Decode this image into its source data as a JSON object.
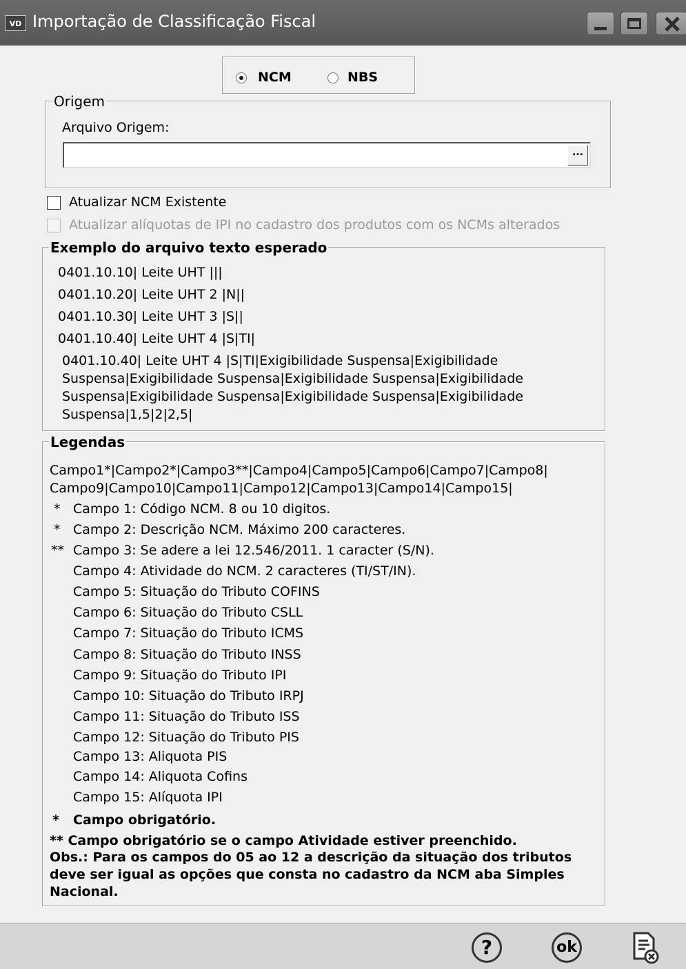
{
  "window": {
    "app_icon": "VD",
    "title": "Importação de Classificação Fiscal"
  },
  "type_selector": {
    "options": [
      {
        "label": "NCM",
        "selected": true
      },
      {
        "label": "NBS",
        "selected": false
      }
    ]
  },
  "origin": {
    "group_title": "Origem",
    "file_label": "Arquivo Origem:",
    "file_value": "",
    "browse_label": "..."
  },
  "options": {
    "update_ncm": {
      "label": "Atualizar NCM Existente",
      "checked": false,
      "enabled": true
    },
    "update_ipi": {
      "label": "Atualizar alíquotas de IPI no cadastro dos produtos com os NCMs alterados",
      "checked": false,
      "enabled": false
    }
  },
  "example": {
    "group_title": "Exemplo do arquivo texto esperado",
    "lines": [
      "0401.10.10| Leite UHT    |||",
      "0401.10.20| Leite UHT 2 |N||",
      "0401.10.30| Leite UHT 3 |S||",
      "0401.10.40| Leite UHT 4 |S|TI|"
    ],
    "long_example": [
      "0401.10.40| Leite UHT 4 |S|TI|Exigibilidade Suspensa|Exigibilidade",
      "Suspensa|Exigibilidade Suspensa|Exigibilidade Suspensa|Exigibilidade",
      "Suspensa|Exigibilidade Suspensa|Exigibilidade Suspensa|Exigibilidade",
      "Suspensa|1,5|2|2,5|"
    ]
  },
  "legend": {
    "group_title": "Legendas",
    "format": [
      "Campo1*|Campo2*|Campo3**|Campo4|Campo5|Campo6|Campo7|Campo8|",
      "Campo9|Campo10|Campo11|Campo12|Campo13|Campo14|Campo15|"
    ],
    "fields": [
      {
        "mark": "*",
        "text": "Campo 1: Código NCM. 8  ou 10 digitos."
      },
      {
        "mark": "*",
        "text": "Campo 2: Descrição NCM. Máximo 200 caracteres."
      },
      {
        "mark": "**",
        "text": "Campo 3: Se adere a lei 12.546/2011. 1 caracter (S/N)."
      },
      {
        "mark": "",
        "text": "Campo 4: Atividade do NCM. 2 caracteres (TI/ST/IN)."
      },
      {
        "mark": "",
        "text": "Campo 5: Situação do Tributo COFINS"
      },
      {
        "mark": "",
        "text": "Campo 6: Situação do Tributo CSLL"
      },
      {
        "mark": "",
        "text": "Campo 7: Situação do Tributo ICMS"
      },
      {
        "mark": "",
        "text": "Campo 8: Situação do Tributo INSS"
      },
      {
        "mark": "",
        "text": "Campo 9: Situação do Tributo IPI"
      },
      {
        "mark": "",
        "text": "Campo 10: Situação do Tributo IRPJ"
      },
      {
        "mark": "",
        "text": "Campo 11: Situação do Tributo ISS"
      },
      {
        "mark": "",
        "text": "Campo 12: Situação do Tributo PIS"
      },
      {
        "mark": "",
        "text": "Campo 13: Aliquota PIS"
      },
      {
        "mark": "",
        "text": "Campo 14: Aliquota Cofins"
      },
      {
        "mark": "",
        "text": "Campo 15: Alíquota IPI"
      }
    ],
    "required_mark": "*",
    "required_text": "Campo obrigatório.",
    "notes": [
      "** Campo obrigatório se o campo Atividade estiver preenchido.",
      "Obs.: Para os campos do 05 ao 12 a descrição da situação dos tributos",
      "deve ser igual as opções que consta no cadastro da NCM aba Simples",
      "Nacional."
    ]
  },
  "footer": {
    "help_label": "?",
    "ok_label": "ok",
    "cancel_icon": "document-cancel-icon"
  }
}
